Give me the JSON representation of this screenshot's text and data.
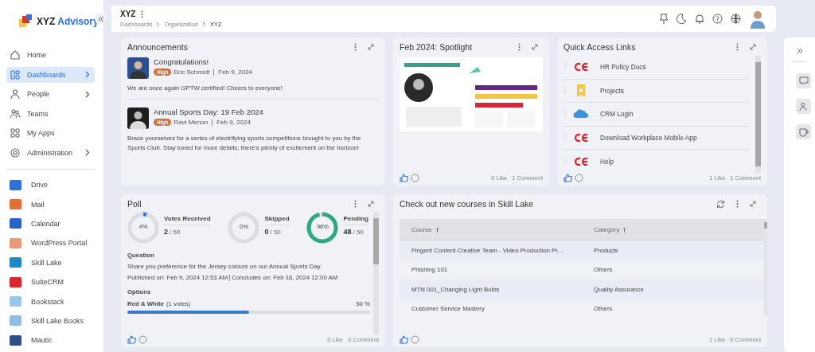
{
  "brand": {
    "name": "XYZ",
    "accent": "Advisory"
  },
  "nav": [
    {
      "label": "Home",
      "kind": "home",
      "selected": false,
      "submenu": false
    },
    {
      "label": "Dashboards",
      "kind": "dashboard",
      "selected": true,
      "submenu": true
    },
    {
      "label": "People",
      "kind": "person",
      "selected": false,
      "submenu": true
    },
    {
      "label": "Teams",
      "kind": "team",
      "selected": false,
      "submenu": false
    },
    {
      "label": "My Apps",
      "kind": "apps",
      "selected": false,
      "submenu": false
    },
    {
      "label": "Administration",
      "kind": "admin",
      "selected": false,
      "submenu": true
    }
  ],
  "apps": [
    {
      "label": "Drive",
      "color": "#2f6fd6"
    },
    {
      "label": "Mail",
      "color": "#e0703a"
    },
    {
      "label": "Calendar",
      "color": "#2b63c9"
    },
    {
      "label": "WordPress Portal",
      "color": "#e89a78"
    },
    {
      "label": "Skill Lake",
      "color": "#1e88c8"
    },
    {
      "label": "SuiteCRM",
      "color": "#d6262e"
    },
    {
      "label": "Bookstack",
      "color": "#9cc6e8"
    },
    {
      "label": "Skill Lake Books",
      "color": "#8fbde3"
    },
    {
      "label": "Mautic",
      "color": "#2f4f8a"
    }
  ],
  "header": {
    "title": "XYZ",
    "breadcrumbs": [
      "Dashboards",
      "Organization",
      "XYZ"
    ]
  },
  "announcements": {
    "title": "Announcements",
    "items": [
      {
        "title": "Congratulations!",
        "priority": "High",
        "author": "Eric Schmidt",
        "date": "Feb 9, 2024",
        "body": "We are once again GPTW certified! Cheers to everyone!",
        "kind": "picture"
      },
      {
        "title": "Annual Sports Day: 19 Feb 2024",
        "priority": "High",
        "author": "Ravi Menon",
        "date": "Feb 9, 2024",
        "body": "Brace yourselves for a series of electrifying sports competitions brought to you by the Sports Club. Stay tuned for more details; there's plenty of excitement on the horizon!",
        "kind": "picture"
      }
    ]
  },
  "spotlight": {
    "title": "Feb 2024: Spotlight",
    "likes": "0 Like",
    "comments": "1 Comment"
  },
  "quick_links": {
    "title": "Quick Access Links",
    "items": [
      {
        "label": "HR Policy Docs",
        "kind": "ce"
      },
      {
        "label": "Projects",
        "kind": "bookmark"
      },
      {
        "label": "CRM Login",
        "kind": "cloud"
      },
      {
        "label": "Download Workplace Mobile App",
        "kind": "ce"
      },
      {
        "label": "Help",
        "kind": "ce"
      }
    ],
    "likes": "1 Like",
    "comments": "1 Comment"
  },
  "poll": {
    "title": "Poll",
    "stats": [
      {
        "label": "Votes Received",
        "percent": "4%",
        "count": "2",
        "total": "/ 50",
        "level": 0.04,
        "color": "#3a7bd5"
      },
      {
        "label": "Skipped",
        "percent": "0%",
        "count": "0",
        "total": "/ 50",
        "level": 0
      },
      {
        "label": "Pending",
        "percent": "96%",
        "count": "48",
        "total": "/ 50",
        "level": 0.96,
        "color": "#2fa882"
      }
    ],
    "question_label": "Question",
    "question": "Share you preference for the Jersey colours on our Annual Sports Day.",
    "published": "Published on: Feb 9, 2024 12:53 AM",
    "concludes": "Concludes on: Feb 16, 2024 12:00 AM",
    "options_label": "Options",
    "options": [
      {
        "label": "Red & White",
        "votes": "(1 votes)",
        "percent": "50 %",
        "level": 0.5
      }
    ],
    "likes": "0 Like",
    "comments": "0 Comment"
  },
  "courses": {
    "title": "Check out new courses in Skill Lake",
    "columns": [
      "Course",
      "Category"
    ],
    "rows": [
      [
        "Fingent Content Creative Team - Video Production Pr...",
        "Products"
      ],
      [
        "Phishing 101",
        "Others"
      ],
      [
        "MTN 001_Changing Light Bulbs",
        "Quality Assurance"
      ],
      [
        "Customer Service Mastery",
        "Others"
      ]
    ],
    "likes": "1 Like",
    "comments": "0 Comment"
  }
}
